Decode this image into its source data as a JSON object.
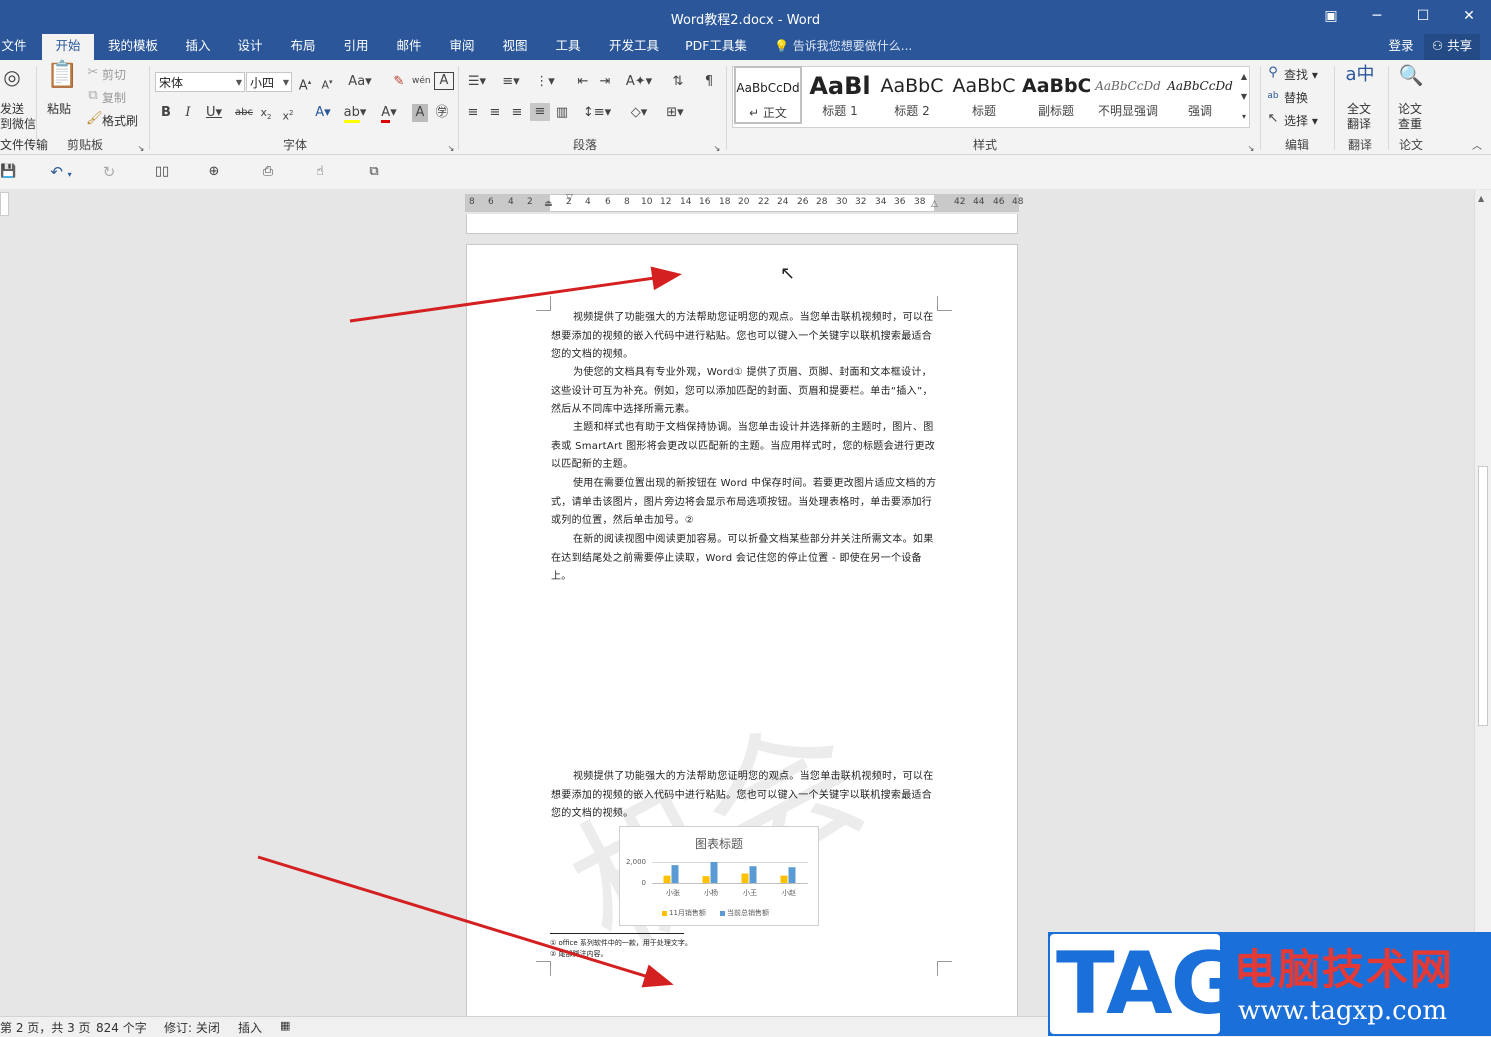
{
  "window": {
    "title": "Word教程2.docx - Word"
  },
  "tabs": [
    "文件",
    "开始",
    "我的模板",
    "插入",
    "设计",
    "布局",
    "引用",
    "邮件",
    "审阅",
    "视图",
    "工具",
    "开发工具",
    "PDF工具集"
  ],
  "tellme": "告诉我您想要做什么...",
  "account": {
    "login": "登录",
    "share": "共享"
  },
  "ribbon": {
    "sendwechat": {
      "line1": "发送",
      "line2": "到微信",
      "group": "文件传输"
    },
    "clipboard": {
      "paste": "粘贴",
      "cut": "剪切",
      "copy": "复制",
      "format_painter": "格式刷",
      "group": "剪贴板"
    },
    "font": {
      "name": "宋体",
      "size": "小四",
      "group": "字体"
    },
    "paragraph": {
      "group": "段落"
    },
    "styles": {
      "group": "样式",
      "items": [
        {
          "sample": "AaBbCcDd",
          "name": "正文",
          "prefix": "↵ "
        },
        {
          "sample": "AaBl",
          "name": "标题 1"
        },
        {
          "sample": "AaBbC",
          "name": "标题 2"
        },
        {
          "sample": "AaBbC",
          "name": "标题"
        },
        {
          "sample": "AaBbC",
          "name": "副标题"
        },
        {
          "sample": "AaBbCcDd",
          "name": "不明显强调"
        },
        {
          "sample": "AaBbCcDd",
          "name": "强调"
        }
      ]
    },
    "editing": {
      "find": "查找",
      "replace": "替换",
      "select": "选择",
      "group": "编辑"
    },
    "translate": {
      "line1": "全文",
      "line2": "翻译",
      "group": "翻译"
    },
    "thesis": {
      "line1": "论文",
      "line2": "查重",
      "group": "论文"
    }
  },
  "ruler": {
    "left": [
      "8",
      "6",
      "4",
      "2"
    ],
    "right": [
      "2",
      "4",
      "6",
      "8",
      "10",
      "12",
      "14",
      "16",
      "18",
      "20",
      "22",
      "24",
      "26",
      "28",
      "30",
      "32",
      "34",
      "36",
      "38"
    ],
    "far": [
      "42",
      "44",
      "46",
      "48"
    ]
  },
  "document": {
    "paragraphs_top": [
      "视频提供了功能强大的方法帮助您证明您的观点。当您单击联机视频时，可以在想要添加的视频的嵌入代码中进行粘贴。您也可以键入一个关键字以联机搜索最适合您的文档的视频。",
      "为使您的文档具有专业外观，Word① 提供了页眉、页脚、封面和文本框设计，这些设计可互为补充。例如，您可以添加匹配的封面、页眉和提要栏。单击“插入”，然后从不同库中选择所需元素。",
      "主题和样式也有助于文档保持协调。当您单击设计并选择新的主题时，图片、图表或 SmartArt 图形将会更改以匹配新的主题。当应用样式时，您的标题会进行更改以匹配新的主题。",
      "使用在需要位置出现的新按钮在 Word 中保存时间。若要更改图片适应文档的方式，请单击该图片，图片旁边将会显示布局选项按钮。当处理表格时，单击要添加行或列的位置，然后单击加号。②",
      "在新的阅读视图中阅读更加容易。可以折叠文档某些部分并关注所需文本。如果在达到结尾处之前需要停止读取，Word 会记住您的停止位置 - 即使在另一个设备上。"
    ],
    "paragraph_bottom": "视频提供了功能强大的方法帮助您证明您的观点。当您单击联机视频时，可以在想要添加的视频的嵌入代码中进行粘贴。您也可以键入一个关键字以联机搜索最适合您的文档的视频。",
    "footnotes": [
      "① office 系列软件中的一款，用于处理文字。",
      "② 尾部脚注内容。"
    ],
    "watermark": "机会"
  },
  "chart_data": {
    "type": "bar",
    "title": "图表标题",
    "categories": [
      "小张",
      "小杨",
      "小王",
      "小赵"
    ],
    "y_ticks": [
      "2,000",
      "0"
    ],
    "ylim": [
      0,
      2600
    ],
    "series": [
      {
        "name": "11月销售额",
        "color": "#ffc000",
        "values": [
          700,
          650,
          900,
          700
        ]
      },
      {
        "name": "当前总销售额",
        "color": "#5b9bd5",
        "values": [
          1700,
          2000,
          1600,
          1500
        ]
      }
    ]
  },
  "status": {
    "page": "第 2 页，共 3 页",
    "words": "824 个字",
    "track": "修订: 关闭",
    "mode": "插入"
  },
  "logo": {
    "tag": "TAG",
    "cn": "电脑技术网",
    "url": "www.tagxp.com"
  }
}
